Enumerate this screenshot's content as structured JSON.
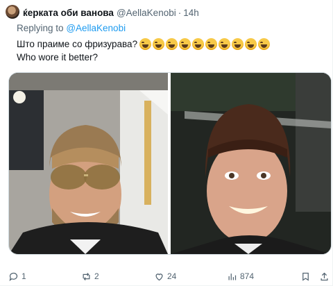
{
  "tweet": {
    "author_name": "ќерката оби ванова",
    "handle": "@AellaKenobi",
    "separator": "·",
    "time": "14h",
    "replying_prefix": "Replying to",
    "replying_to": "@AellaKenobi",
    "line1": "Што праиме со фризурава?",
    "emoji_count": 10,
    "emoji_name": "face-with-tears-of-joy",
    "line2": "Who wore it better?"
  },
  "actions": {
    "replies": "1",
    "reposts": "2",
    "likes": "24",
    "views": "874"
  },
  "colors": {
    "link": "#1d9bf0",
    "secondary_text": "#536471",
    "primary_text": "#0f1419"
  }
}
